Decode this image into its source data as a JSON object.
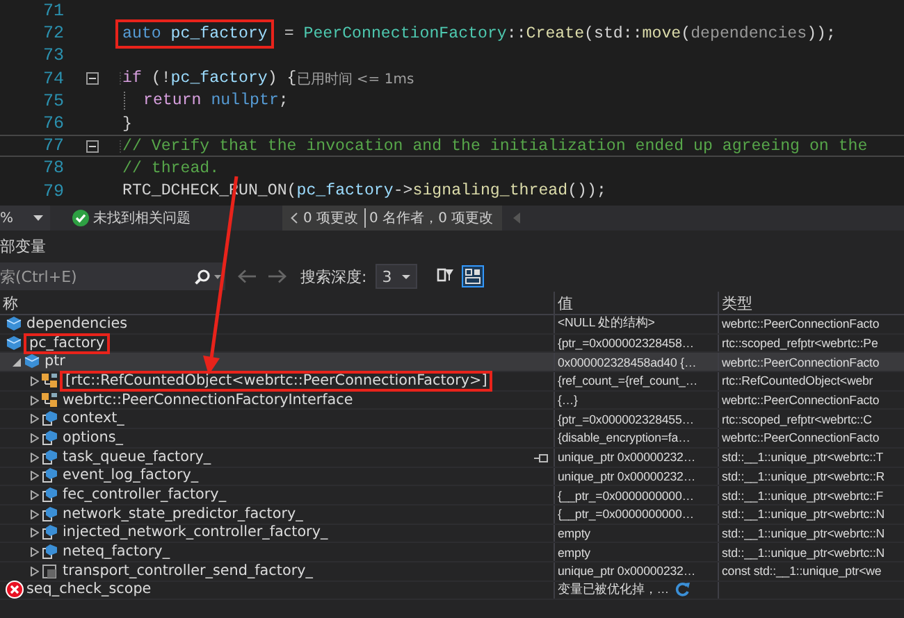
{
  "editor": {
    "lines": [
      {
        "number": "71",
        "fold": false,
        "current": false
      },
      {
        "number": "72",
        "fold": false,
        "current": false,
        "segments": [
          {
            "kind": "box",
            "segments": [
              {
                "text": "auto",
                "kind": "keyword"
              },
              {
                "text": " pc_factory",
                "kind": "var"
              }
            ]
          },
          {
            "text": " = ",
            "kind": "plain"
          },
          {
            "text": "PeerConnectionFactory",
            "kind": "type"
          },
          {
            "text": "::",
            "kind": "plain"
          },
          {
            "text": "Create",
            "kind": "func"
          },
          {
            "text": "(std::",
            "kind": "plain"
          },
          {
            "text": "move",
            "kind": "func"
          },
          {
            "text": "(",
            "kind": "plain"
          },
          {
            "text": "dependencies",
            "kind": "param"
          },
          {
            "text": "));",
            "kind": "plain"
          }
        ]
      },
      {
        "number": "73",
        "fold": false,
        "current": false
      },
      {
        "number": "74",
        "fold": true,
        "current": false,
        "segments": [
          {
            "text": "if",
            "kind": "control"
          },
          {
            "text": " (!",
            "kind": "plain"
          },
          {
            "text": "pc_factory",
            "kind": "var"
          },
          {
            "text": ") {",
            "kind": "plain"
          },
          {
            "text": "已用时间 <= 1ms",
            "kind": "hint"
          }
        ]
      },
      {
        "number": "75",
        "fold": false,
        "current": false,
        "segments": [
          {
            "text": "return",
            "kind": "control",
            "indent": true
          },
          {
            "text": " nullptr",
            "kind": "keyword"
          },
          {
            "text": ";",
            "kind": "plain"
          }
        ]
      },
      {
        "number": "76",
        "fold": false,
        "current": false,
        "segments": [
          {
            "text": "}",
            "kind": "plain"
          }
        ]
      },
      {
        "number": "77",
        "fold": true,
        "current": true,
        "segments": [
          {
            "text": "// Verify that the invocation and the initialization ended up agreeing on the",
            "kind": "comment"
          }
        ]
      },
      {
        "number": "78",
        "fold": false,
        "current": false,
        "segments": [
          {
            "text": "// thread.",
            "kind": "comment"
          }
        ]
      },
      {
        "number": "79",
        "fold": false,
        "current": false,
        "segments": [
          {
            "text": "RTC_DCHECK_RUN_ON",
            "kind": "macro"
          },
          {
            "text": "(",
            "kind": "plain"
          },
          {
            "text": "pc_factory",
            "kind": "var"
          },
          {
            "text": "->",
            "kind": "plain"
          },
          {
            "text": "signaling_thread",
            "kind": "func"
          },
          {
            "text": "());",
            "kind": "plain"
          }
        ]
      }
    ]
  },
  "status_bar": {
    "zoom": "%",
    "issues": "未找到相关问题",
    "changes": "0 项更改",
    "authors": "0 名作者，0 项更改"
  },
  "locals_panel": {
    "title": "部变量",
    "search": {
      "placeholder": "索(Ctrl+E)"
    },
    "depth_label": "搜索深度:",
    "depth": "3",
    "columns": [
      "称",
      "值",
      "类型"
    ],
    "rows": [
      {
        "name": "dependencies",
        "kind": "local",
        "value": "<NULL 处的结构>",
        "type": "webrtc::PeerConnectionFacto",
        "selected": false,
        "highlighted": false,
        "pinned": false
      },
      {
        "name": "pc_factory",
        "kind": "local",
        "value": "{ptr_=0x000002328458…",
        "type": "rtc::scoped_refptr<webrtc::Pe",
        "selected": false,
        "highlighted": true,
        "pinned": false,
        "children": [
          {
            "name": "ptr",
            "kind": "local",
            "value": "0x000002328458ad40 {…",
            "type": "webrtc::PeerConnectionFacto",
            "selected": true,
            "highlighted": false,
            "pinned": false,
            "expanded": true,
            "children": [
              {
                "name": "[rtc::RefCountedObject<webrtc::PeerConnectionFactory>]",
                "kind": "base",
                "value": "{ref_count_={ref_count_…",
                "type": "rtc::RefCountedObject<webr",
                "selected": false,
                "highlighted": true,
                "pinned": false,
                "expanded": false
              },
              {
                "name": "webrtc::PeerConnectionFactoryInterface",
                "kind": "base",
                "value": "{…}",
                "type": "webrtc::PeerConnectionFacto",
                "selected": false,
                "highlighted": false,
                "pinned": false,
                "expanded": false
              },
              {
                "name": "context_",
                "kind": "field",
                "value": "{ptr_=0x000002328455…",
                "type": "rtc::scoped_refptr<webrtc::C",
                "selected": false,
                "highlighted": false,
                "pinned": false,
                "expanded": false
              },
              {
                "name": "options_",
                "kind": "field",
                "value": "{disable_encryption=fa…",
                "type": "webrtc::PeerConnectionFacto",
                "selected": false,
                "highlighted": false,
                "pinned": false,
                "expanded": false
              },
              {
                "name": "task_queue_factory_",
                "kind": "field",
                "value": "unique_ptr 0x00000232…",
                "type": "std::__1::unique_ptr<webrtc::T",
                "selected": false,
                "highlighted": false,
                "pinned": true,
                "expanded": false
              },
              {
                "name": "event_log_factory_",
                "kind": "field",
                "value": "unique_ptr 0x00000232…",
                "type": "std::__1::unique_ptr<webrtc::R",
                "selected": false,
                "highlighted": false,
                "pinned": false,
                "expanded": false
              },
              {
                "name": "fec_controller_factory_",
                "kind": "field",
                "value": "{__ptr_=0x0000000000…",
                "type": "std::__1::unique_ptr<webrtc::F",
                "selected": false,
                "highlighted": false,
                "pinned": false,
                "expanded": false
              },
              {
                "name": "network_state_predictor_factory_",
                "kind": "field",
                "value": "{__ptr_=0x0000000000…",
                "type": "std::__1::unique_ptr<webrtc::N",
                "selected": false,
                "highlighted": false,
                "pinned": false,
                "expanded": false
              },
              {
                "name": "injected_network_controller_factory_",
                "kind": "field",
                "value": "empty",
                "type": "std::__1::unique_ptr<webrtc::N",
                "selected": false,
                "highlighted": false,
                "pinned": false,
                "expanded": false
              },
              {
                "name": "neteq_factory_",
                "kind": "field",
                "value": "empty",
                "type": "std::__1::unique_ptr<webrtc::N",
                "selected": false,
                "highlighted": false,
                "pinned": false,
                "expanded": false
              },
              {
                "name": "transport_controller_send_factory_",
                "kind": "const-field",
                "value": "unique_ptr 0x00000232…",
                "type": "const std::__1::unique_ptr<we",
                "selected": false,
                "highlighted": false,
                "pinned": false,
                "expanded": false
              }
            ]
          }
        ]
      },
      {
        "name": "seq_check_scope",
        "kind": "error",
        "value": "变量已被优化掉，…",
        "refresh": true,
        "selected": false,
        "highlighted": false,
        "pinned": false
      }
    ]
  }
}
